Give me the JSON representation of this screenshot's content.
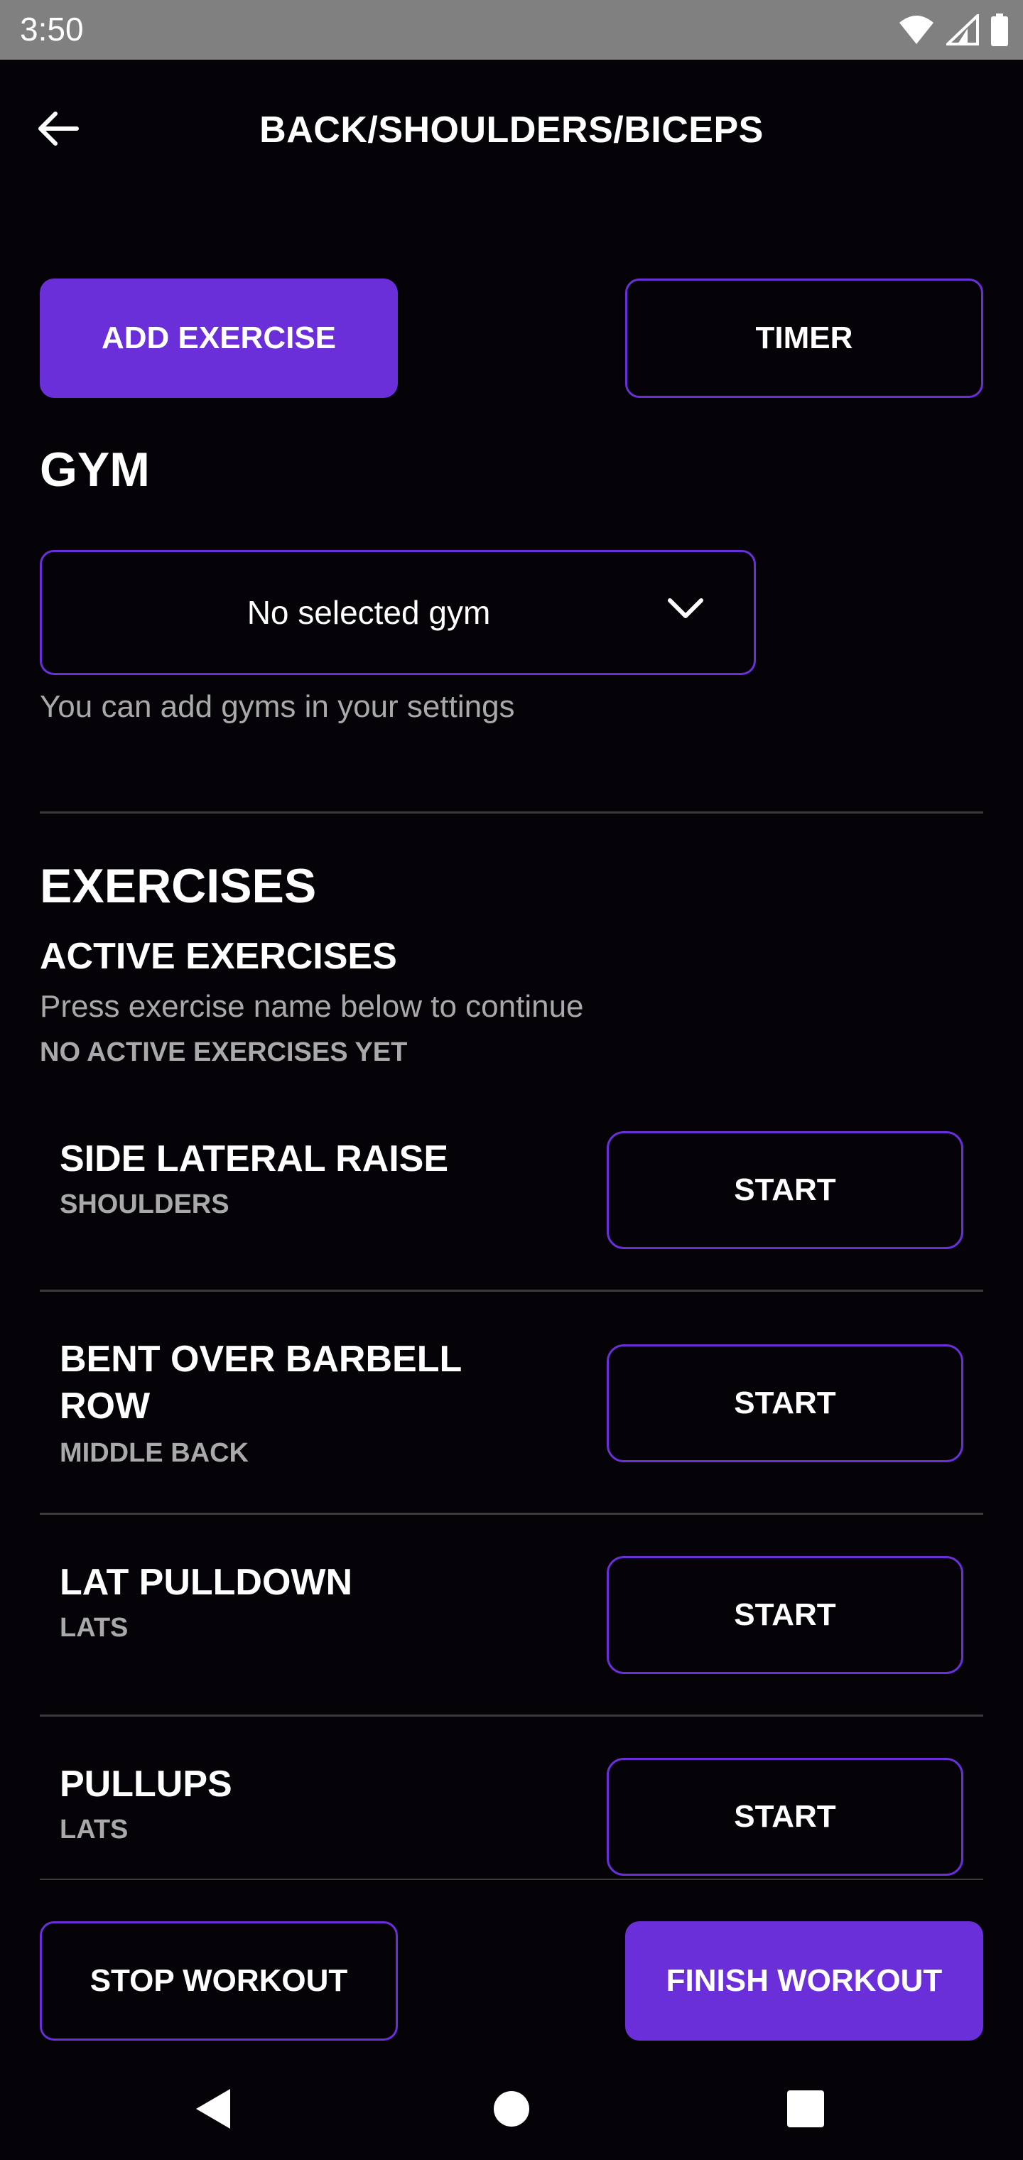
{
  "status_bar": {
    "time": "3:50",
    "icons": [
      "wifi-icon",
      "cellular-signal-icon",
      "battery-icon"
    ]
  },
  "header": {
    "title": "BACK/SHOULDERS/BICEPS",
    "back_icon": "arrow-left-icon"
  },
  "actions": {
    "add_exercise_label": "ADD EXERCISE",
    "timer_label": "TIMER"
  },
  "gym": {
    "title": "GYM",
    "selected": "No selected gym",
    "helper": "You can add gyms in your settings",
    "chevron_icon": "chevron-down-icon"
  },
  "exercises": {
    "title": "EXERCISES",
    "active_title": "ACTIVE EXERCISES",
    "active_hint": "Press exercise name below to continue",
    "active_empty": "NO ACTIVE EXERCISES YET",
    "items": [
      {
        "name": "SIDE LATERAL RAISE",
        "muscle": "SHOULDERS",
        "action": "START"
      },
      {
        "name": "BENT OVER BARBELL ROW",
        "muscle": "MIDDLE BACK",
        "action": "START"
      },
      {
        "name": "LAT PULLDOWN",
        "muscle": "LATS",
        "action": "START"
      },
      {
        "name": "PULLUPS",
        "muscle": "LATS",
        "action": "START"
      }
    ]
  },
  "footer": {
    "stop_label": "STOP WORKOUT",
    "finish_label": "FINISH WORKOUT"
  },
  "nav": {
    "back_icon": "nav-back-icon",
    "home_icon": "nav-home-icon",
    "recents_icon": "nav-recents-icon"
  },
  "colors": {
    "accent": "#6a2fd8",
    "background": "#050307",
    "status_bar": "#808080",
    "muted_text": "#a9a9a9"
  }
}
